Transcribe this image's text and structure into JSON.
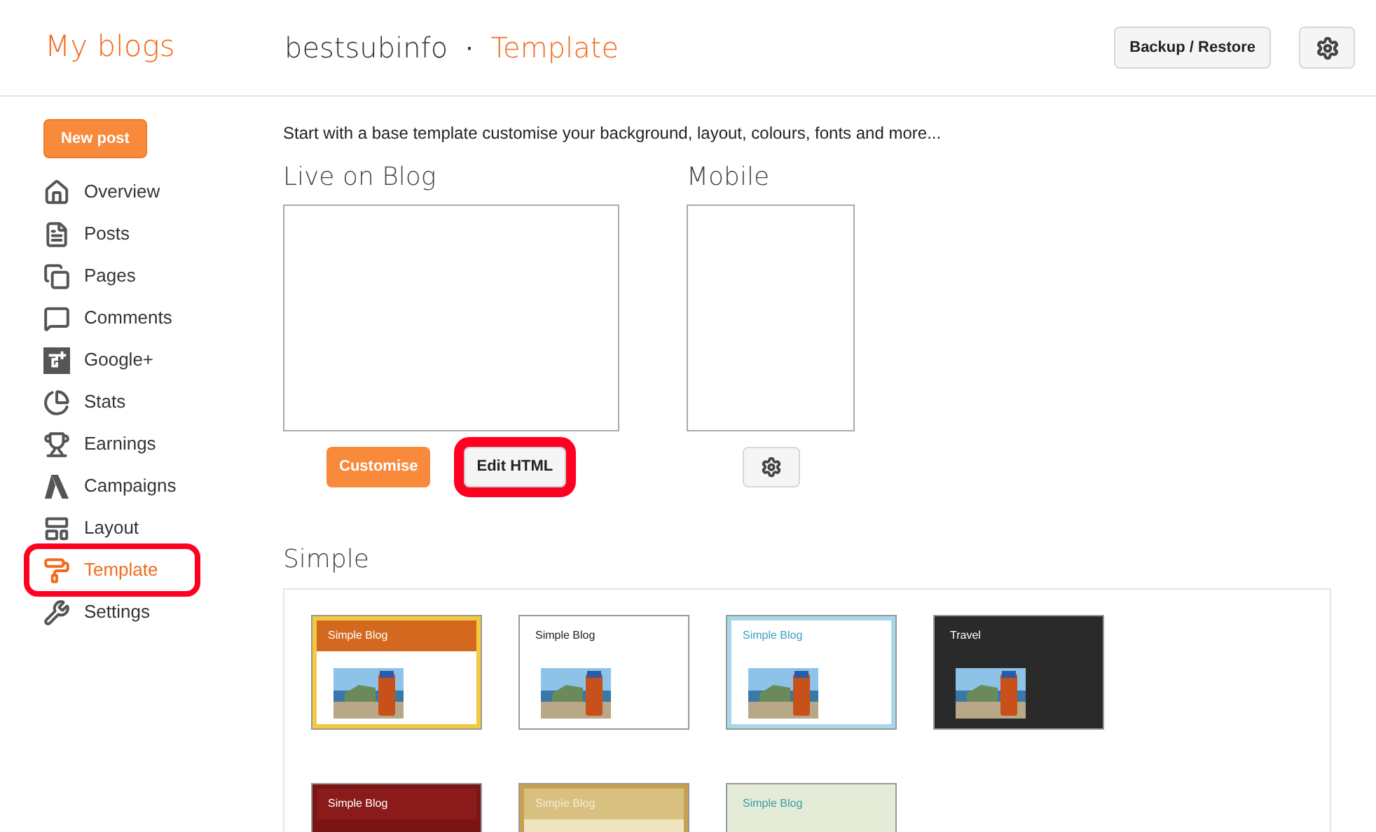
{
  "header": {
    "title": "My blogs",
    "blog_name": "bestsubinfo",
    "separator": "·",
    "section": "Template",
    "backup_button": "Backup / Restore"
  },
  "sidebar": {
    "new_post": "New post",
    "items": [
      {
        "label": "Overview",
        "selected": false,
        "highlighted": false
      },
      {
        "label": "Posts",
        "selected": false,
        "highlighted": false
      },
      {
        "label": "Pages",
        "selected": false,
        "highlighted": false
      },
      {
        "label": "Comments",
        "selected": false,
        "highlighted": false
      },
      {
        "label": "Google+",
        "selected": false,
        "highlighted": false
      },
      {
        "label": "Stats",
        "selected": false,
        "highlighted": false
      },
      {
        "label": "Earnings",
        "selected": false,
        "highlighted": false
      },
      {
        "label": "Campaigns",
        "selected": false,
        "highlighted": false
      },
      {
        "label": "Layout",
        "selected": false,
        "highlighted": false
      },
      {
        "label": "Template",
        "selected": true,
        "highlighted": true
      },
      {
        "label": "Settings",
        "selected": false,
        "highlighted": false
      }
    ]
  },
  "intro": "Start with a base template customise your background, layout, colours, fonts and more...",
  "live": {
    "title": "Live on Blog",
    "customise": "Customise",
    "edit_html": "Edit HTML",
    "edit_highlighted": true
  },
  "mobile": {
    "title": "Mobile"
  },
  "gallery": {
    "title": "Simple",
    "templates": [
      {
        "name": "Simple Blog",
        "kind": "orange"
      },
      {
        "name": "Simple Blog",
        "kind": "white"
      },
      {
        "name": "Simple Blog",
        "kind": "blue"
      },
      {
        "name": "Travel",
        "kind": "dark"
      },
      {
        "name": "Simple Blog",
        "kind": "red"
      },
      {
        "name": "Simple Blog",
        "kind": "gold"
      },
      {
        "name": "Simple Blog",
        "kind": "green"
      }
    ]
  }
}
